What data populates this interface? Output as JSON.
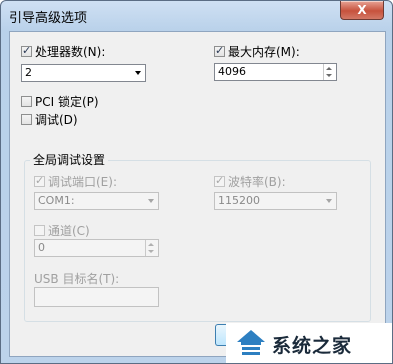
{
  "window": {
    "title": "引导高级选项",
    "close_label": "X"
  },
  "processors": {
    "checkbox_label": "处理器数(N):",
    "checked": true,
    "selected": "2"
  },
  "max_memory": {
    "checkbox_label": "最大内存(M):",
    "checked": true,
    "value": "4096"
  },
  "pci_lock": {
    "label": "PCI 锁定(P)",
    "checked": false
  },
  "debug": {
    "label": "调试(D)",
    "checked": false
  },
  "global_debug": {
    "title": "全局调试设置",
    "debug_port": {
      "label": "调试端口(E):",
      "checked": true,
      "selected": "COM1:"
    },
    "baud_rate": {
      "label": "波特率(B):",
      "checked": true,
      "selected": "115200"
    },
    "channel": {
      "label": "通道(C)",
      "checked": false,
      "value": "0"
    },
    "usb_target": {
      "label": "USB 目标名(T):",
      "value": ""
    }
  },
  "watermark": {
    "text": "系统之家"
  },
  "colors": {
    "close_button": "#c7523d",
    "window_frame": "#bcd3eb",
    "client_bg": "#f0f0f0"
  }
}
